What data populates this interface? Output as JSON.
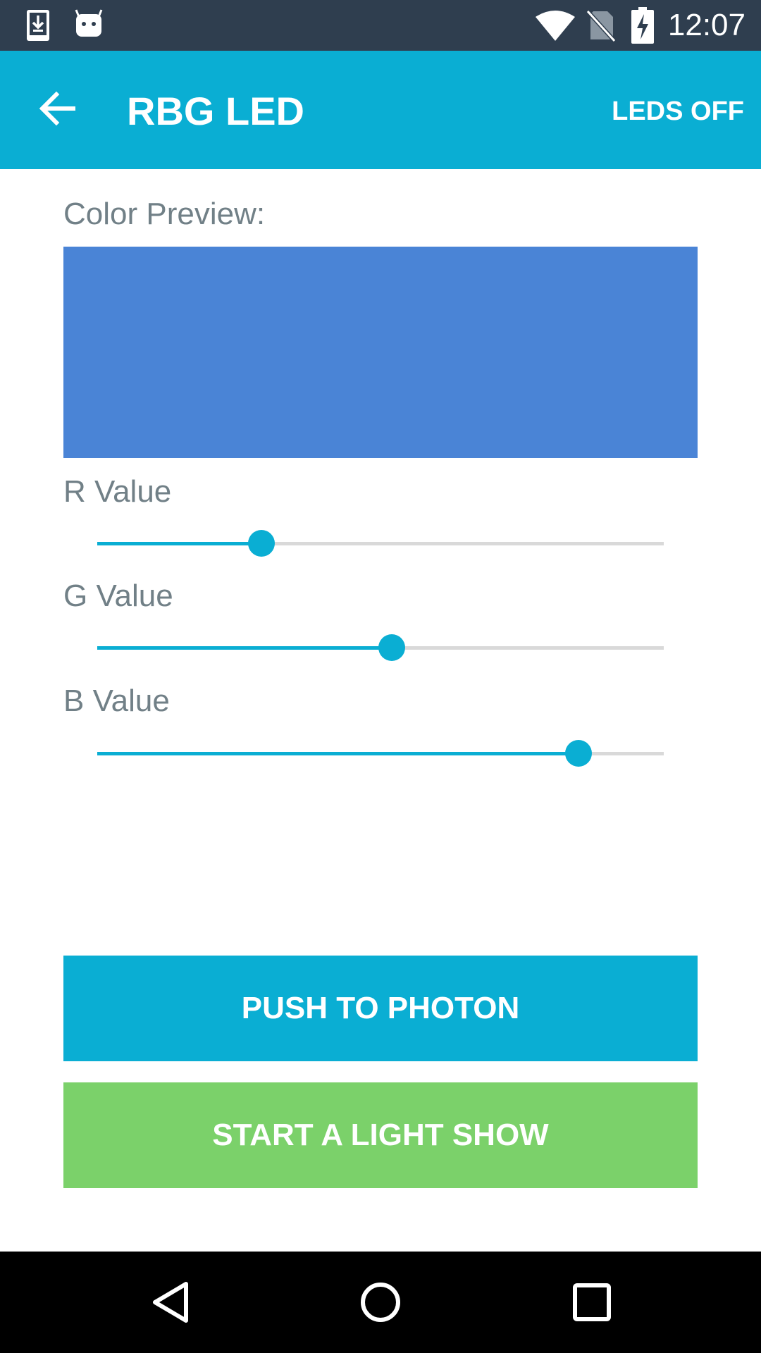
{
  "status_bar": {
    "time": "12:07",
    "icons": [
      "download-icon",
      "android-icon",
      "wifi-icon",
      "no-sim-icon",
      "battery-charging-icon"
    ]
  },
  "app_bar": {
    "title": "RBG LED",
    "action_label": "LEDS OFF",
    "back_icon": "arrow-left-icon"
  },
  "preview": {
    "label": "Color Preview:",
    "color": "#4a84d6"
  },
  "sliders": [
    {
      "label": "R Value",
      "level_fraction": 0.29
    },
    {
      "label": "G Value",
      "level_fraction": 0.52
    },
    {
      "label": "B Value",
      "level_fraction": 0.85
    }
  ],
  "buttons": {
    "push_label": "PUSH TO PHOTON",
    "light_show_label": "START A LIGHT SHOW"
  },
  "colors": {
    "accent": "#0aaed3",
    "push_button": "#0aaed3",
    "light_show_button": "#7bd16a",
    "status_bar": "#2f3e4f",
    "label_text": "#718087"
  },
  "nav_bar": {
    "icons": [
      "back-triangle-icon",
      "home-circle-icon",
      "recents-square-icon"
    ]
  }
}
